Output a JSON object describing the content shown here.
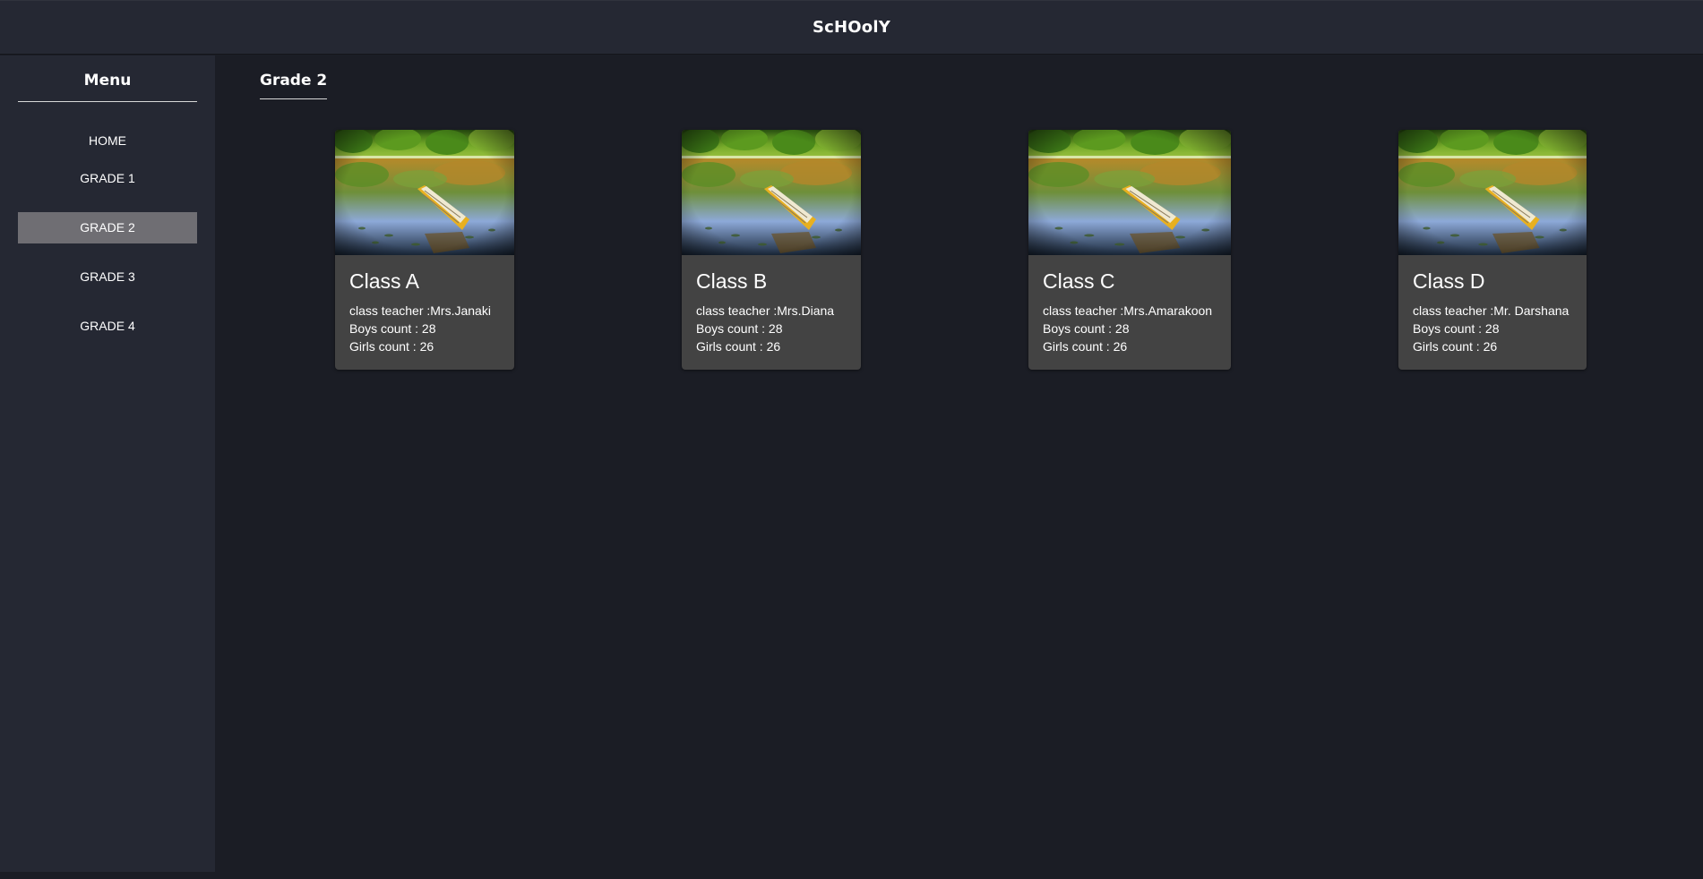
{
  "header": {
    "title": "ScHOolY"
  },
  "sidebar": {
    "title": "Menu",
    "items": [
      {
        "label": "HOME"
      },
      {
        "label": "GRADE 1"
      },
      {
        "label": "GRADE 2"
      },
      {
        "label": "GRADE 3"
      },
      {
        "label": "GRADE 4"
      }
    ],
    "active_item": "GRADE 2",
    "active_color": "#6f6e73"
  },
  "main": {
    "title": "Grade 2",
    "cards": [
      {
        "title": "Class A",
        "teacher": "class teacher :Mrs.Janaki",
        "boys": "Boys count : 28",
        "girls": "Girls count : 26",
        "image": "lake-canoe-image"
      },
      {
        "title": "Class B",
        "teacher": "class teacher :Mrs.Diana",
        "boys": "Boys count : 28",
        "girls": "Girls count : 26",
        "image": "lake-canoe-image"
      },
      {
        "title": "Class C",
        "teacher": "class teacher :Mrs.Amarakoon",
        "boys": "Boys count : 28",
        "girls": "Girls count : 26",
        "image": "lake-canoe-image"
      },
      {
        "title": "Class D",
        "teacher": "class teacher :Mr. Darshana",
        "boys": "Boys count : 28",
        "girls": "Girls count : 26",
        "image": "lake-canoe-image"
      }
    ]
  },
  "colors": {
    "background": "#1b1d25",
    "header": "#252833",
    "sidebar": "#252833",
    "card": "#434343"
  }
}
